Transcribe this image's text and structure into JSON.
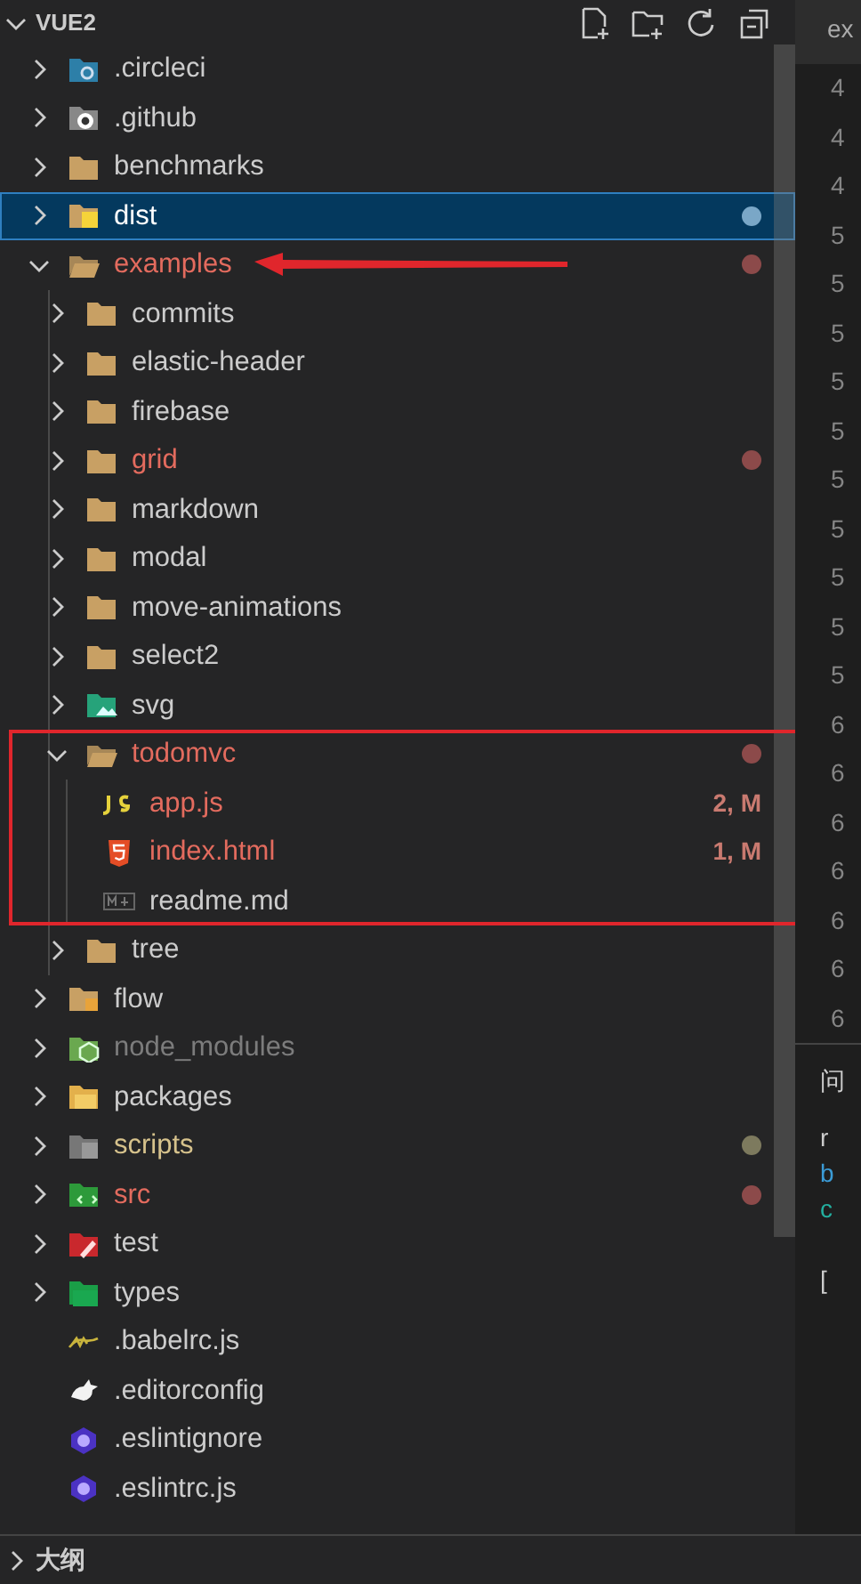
{
  "explorer": {
    "title": "VUE2",
    "expanded": true,
    "tree": [
      {
        "label": ".circleci",
        "kind": "cifolder",
        "expanded": false,
        "selected": false,
        "error": false,
        "warning": false,
        "ignored": false
      },
      {
        "label": ".github",
        "kind": "gitfolder",
        "expanded": false,
        "selected": false,
        "error": false,
        "warning": false,
        "ignored": false
      },
      {
        "label": "benchmarks",
        "kind": "folder",
        "expanded": false,
        "selected": false,
        "error": false,
        "warning": false,
        "ignored": false
      },
      {
        "label": "dist",
        "kind": "distfolder",
        "expanded": false,
        "selected": true,
        "error": false,
        "warning": false,
        "ignored": false,
        "color": "#7aa7c7"
      },
      {
        "label": "examples",
        "kind": "folder",
        "expanded": true,
        "selected": false,
        "error": true,
        "warning": false,
        "ignored": false,
        "color": "#8c4a4a",
        "arrow_marked": true,
        "children": [
          {
            "label": "commits",
            "kind": "folder",
            "expanded": false,
            "selected": false,
            "error": false,
            "warning": false,
            "ignored": false
          },
          {
            "label": "elastic-header",
            "kind": "folder",
            "expanded": false,
            "selected": false,
            "error": false,
            "warning": false,
            "ignored": false
          },
          {
            "label": "firebase",
            "kind": "folder",
            "expanded": false,
            "selected": false,
            "error": false,
            "warning": false,
            "ignored": false
          },
          {
            "label": "grid",
            "kind": "folder",
            "expanded": false,
            "selected": false,
            "error": true,
            "warning": false,
            "ignored": false,
            "color": "#8c4a4a"
          },
          {
            "label": "markdown",
            "kind": "folder",
            "expanded": false,
            "selected": false,
            "error": false,
            "warning": false,
            "ignored": false
          },
          {
            "label": "modal",
            "kind": "folder",
            "expanded": false,
            "selected": false,
            "error": false,
            "warning": false,
            "ignored": false
          },
          {
            "label": "move-animations",
            "kind": "folder",
            "expanded": false,
            "selected": false,
            "error": false,
            "warning": false,
            "ignored": false
          },
          {
            "label": "select2",
            "kind": "folder",
            "expanded": false,
            "selected": false,
            "error": false,
            "warning": false,
            "ignored": false
          },
          {
            "label": "svg",
            "kind": "svgfolder",
            "expanded": false,
            "selected": false,
            "error": false,
            "warning": false,
            "ignored": false
          },
          {
            "label": "todomvc",
            "kind": "folder",
            "expanded": true,
            "selected": false,
            "error": true,
            "warning": false,
            "ignored": false,
            "color": "#8c4a4a",
            "boxed": true,
            "children": [
              {
                "label": "app.js",
                "kind": "js",
                "selected": false,
                "error": true,
                "warning": false,
                "ignored": false,
                "badge": "2, M"
              },
              {
                "label": "index.html",
                "kind": "html",
                "selected": false,
                "error": true,
                "warning": false,
                "ignored": false,
                "badge": "1, M"
              },
              {
                "label": "readme.md",
                "kind": "md",
                "selected": false,
                "error": false,
                "warning": false,
                "ignored": false
              }
            ]
          },
          {
            "label": "tree",
            "kind": "folder",
            "expanded": false,
            "selected": false,
            "error": false,
            "warning": false,
            "ignored": false
          }
        ]
      },
      {
        "label": "flow",
        "kind": "flowfolder",
        "expanded": false,
        "selected": false,
        "error": false,
        "warning": false,
        "ignored": false
      },
      {
        "label": "node_modules",
        "kind": "nodefolder",
        "expanded": false,
        "selected": false,
        "error": false,
        "warning": false,
        "ignored": true
      },
      {
        "label": "packages",
        "kind": "pkgfolder",
        "expanded": false,
        "selected": false,
        "error": false,
        "warning": false,
        "ignored": false
      },
      {
        "label": "scripts",
        "kind": "scriptfolder",
        "expanded": false,
        "selected": false,
        "error": false,
        "warning": true,
        "ignored": false,
        "color": "#7d7a5e"
      },
      {
        "label": "src",
        "kind": "srcfolder",
        "expanded": false,
        "selected": false,
        "error": true,
        "warning": false,
        "ignored": false,
        "color": "#8c4a4a"
      },
      {
        "label": "test",
        "kind": "testfolder",
        "expanded": false,
        "selected": false,
        "error": false,
        "warning": false,
        "ignored": false
      },
      {
        "label": "types",
        "kind": "typesfolder",
        "expanded": false,
        "selected": false,
        "error": false,
        "warning": false,
        "ignored": false
      },
      {
        "label": ".babelrc.js",
        "kind": "babel",
        "selected": false,
        "error": false,
        "warning": false,
        "ignored": false
      },
      {
        "label": ".editorconfig",
        "kind": "editorconfig",
        "selected": false,
        "error": false,
        "warning": false,
        "ignored": false
      },
      {
        "label": ".eslintignore",
        "kind": "eslint",
        "selected": false,
        "error": false,
        "warning": false,
        "ignored": false
      },
      {
        "label": ".eslintrc.js",
        "kind": "eslint",
        "selected": false,
        "error": false,
        "warning": false,
        "ignored": false
      }
    ]
  },
  "outline": {
    "title": "大纲",
    "expanded": false
  },
  "editor": {
    "tab": "ex",
    "line_numbers": [
      "4",
      "4",
      "4",
      "5",
      "5",
      "5",
      "5",
      "5",
      "5",
      "5",
      "5",
      "5",
      "5",
      "6",
      "6",
      "6",
      "6",
      "6",
      "6",
      "6"
    ],
    "panel": {
      "tab": "问",
      "lines": [
        {
          "text": "r",
          "color": "#cccccc"
        },
        {
          "text": "b",
          "color": "#3b9bd6"
        },
        {
          "text": "c",
          "color": "#23b0a0"
        },
        {
          "text": "[",
          "color": "#cccccc"
        }
      ]
    }
  }
}
